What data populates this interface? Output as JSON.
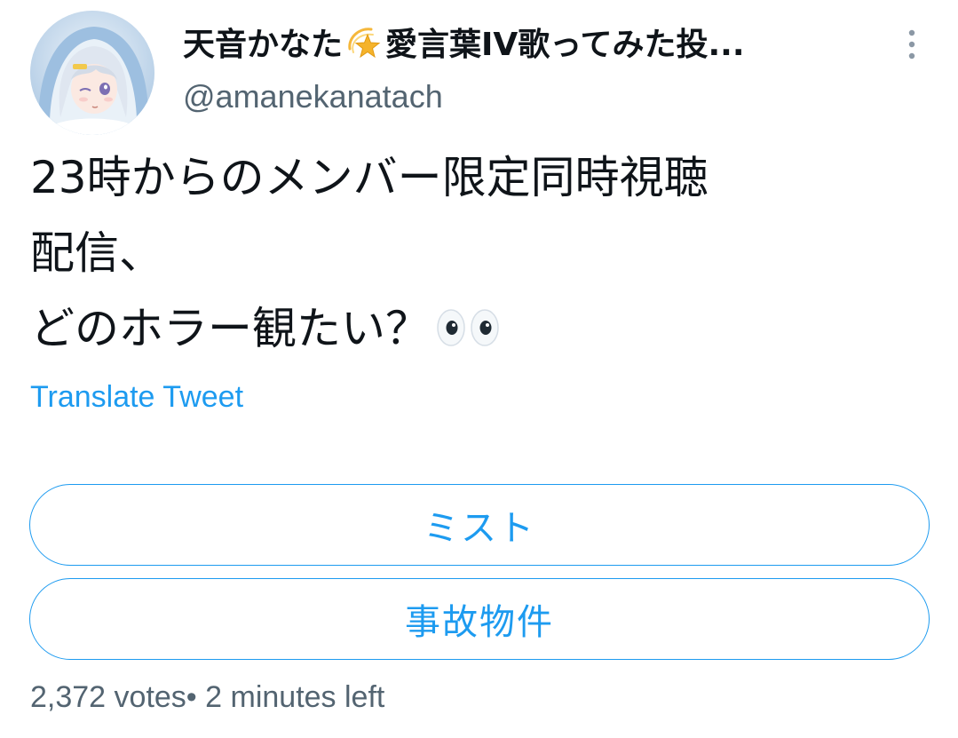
{
  "author": {
    "display_name_part1": "天音かなた",
    "display_name_emoji": "dizzy-star-icon",
    "display_name_part2": "愛言葉IV歌ってみた投...",
    "handle": "@amanekanatach",
    "avatar": "avatar-image"
  },
  "more_icon": "vertical-ellipsis-icon",
  "tweet": {
    "lines": [
      "23時からのメンバー限定同時視聴",
      "配信、",
      "どのホラー観たい？"
    ],
    "trailing_emoji": "eyes-icon"
  },
  "translate_label": "Translate Tweet",
  "poll": {
    "options": [
      {
        "label": "ミスト"
      },
      {
        "label": "事故物件"
      }
    ],
    "votes": "2,372 votes",
    "separator": "• ",
    "time_left": "2 minutes left"
  },
  "colors": {
    "accent": "#1d9bf0",
    "text_primary": "#0f1419",
    "text_secondary": "#536471"
  }
}
